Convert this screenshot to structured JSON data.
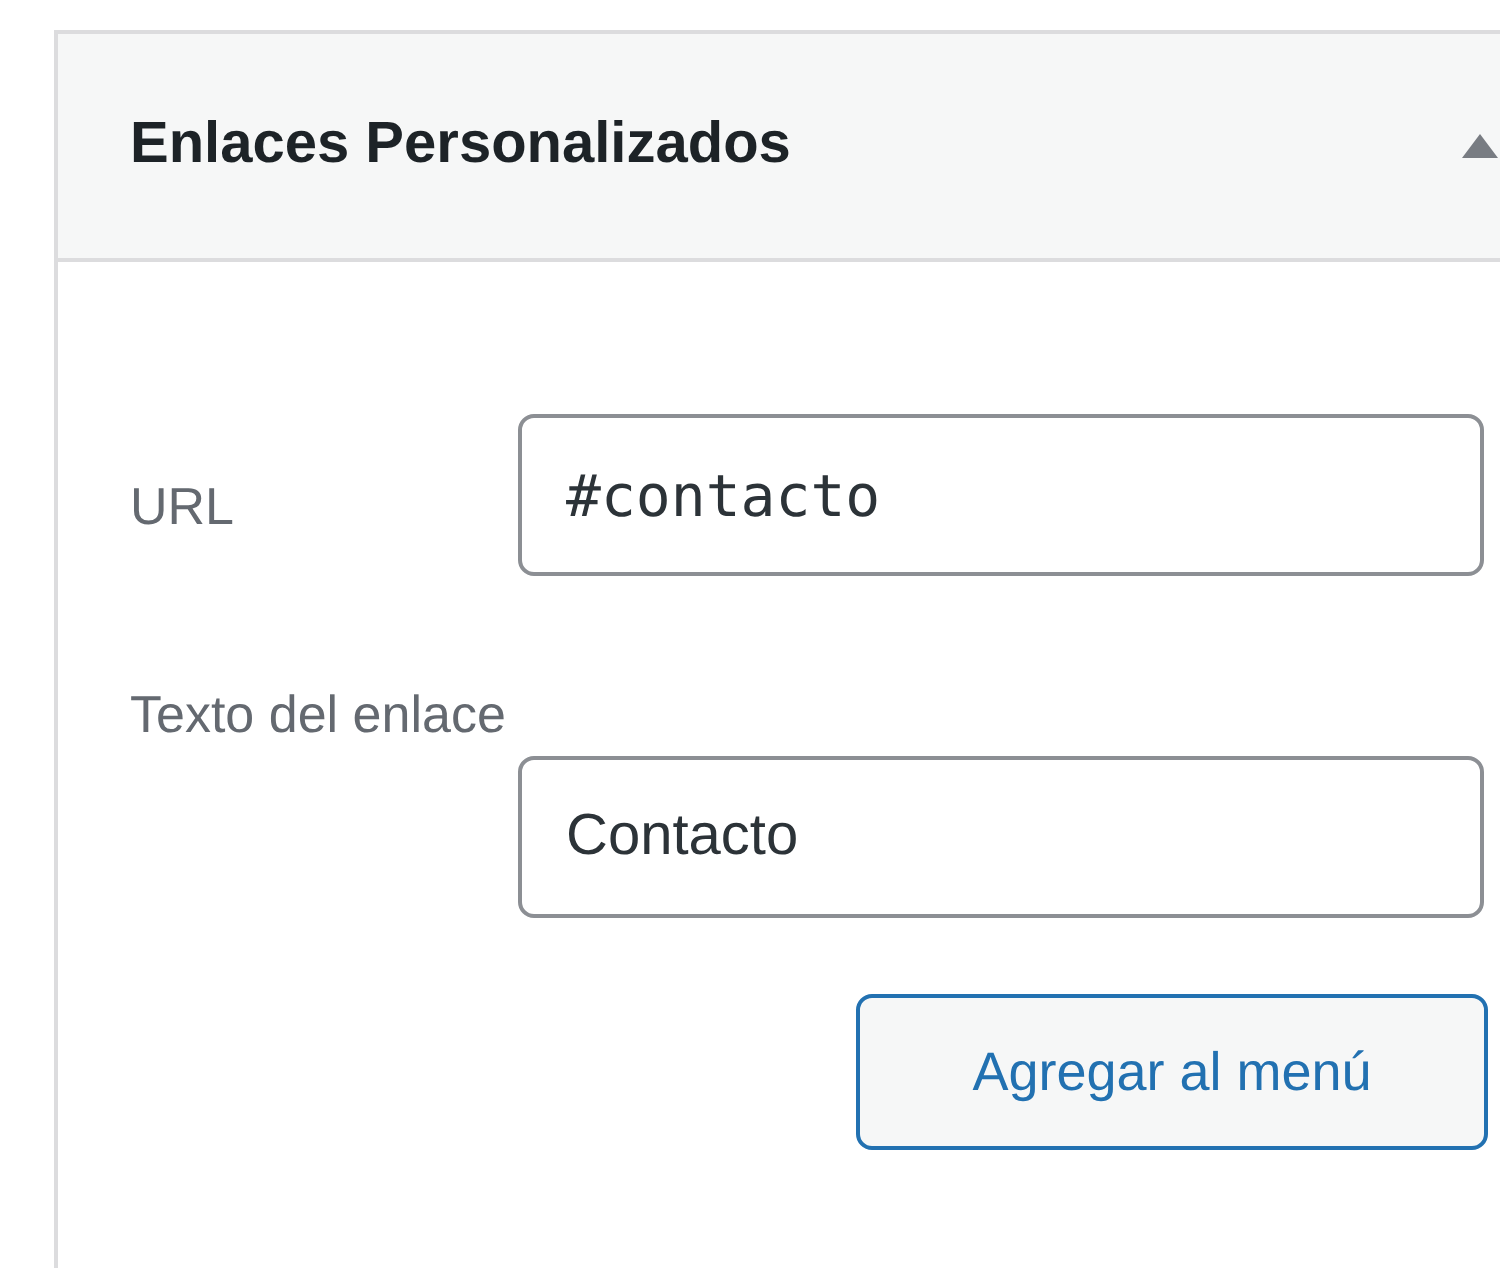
{
  "panel": {
    "title": "Enlaces Personalizados",
    "expanded": true
  },
  "fields": [
    {
      "kind": "inline",
      "label": "URL",
      "value": "#contacto",
      "mono": true
    },
    {
      "kind": "stacked",
      "label": "Texto del enlace",
      "value": "Contacto",
      "mono": false
    }
  ],
  "button": "Agregar al menú"
}
